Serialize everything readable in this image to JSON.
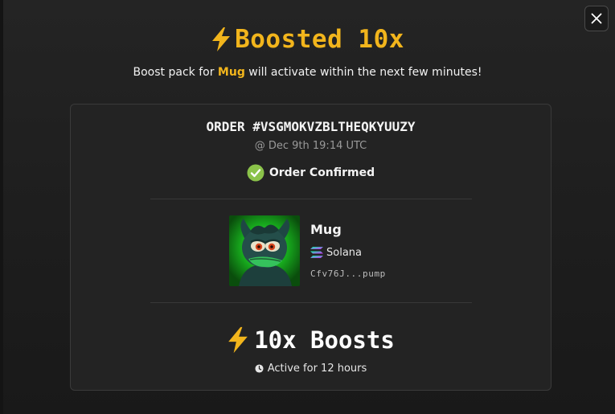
{
  "modal": {
    "title": "Boosted 10x",
    "subtitle_prefix": "Boost pack for",
    "coin_name": "Mug",
    "subtitle_suffix": "will activate within the next few minutes!",
    "close_icon": "close-icon"
  },
  "order": {
    "id_text": "ORDER #VSGMOKVZBLTHEQKYUUZY",
    "time_text": "@ Dec 9th 19:14 UTC",
    "status_text": "Order Confirmed",
    "status_icon": "check-circle-icon"
  },
  "token": {
    "name": "Mug",
    "chain": "Solana",
    "chain_icon": "solana-icon",
    "address": "Cfv76J...pump",
    "image_icon": "token-avatar"
  },
  "boost": {
    "amount_text": "10x Boosts",
    "active_text": "Active for 12 hours",
    "clock_icon": "clock-icon"
  },
  "colors": {
    "accent": "#f2b51c",
    "success": "#8bc34a",
    "background": "#1e1e1e",
    "card": "#232323"
  }
}
